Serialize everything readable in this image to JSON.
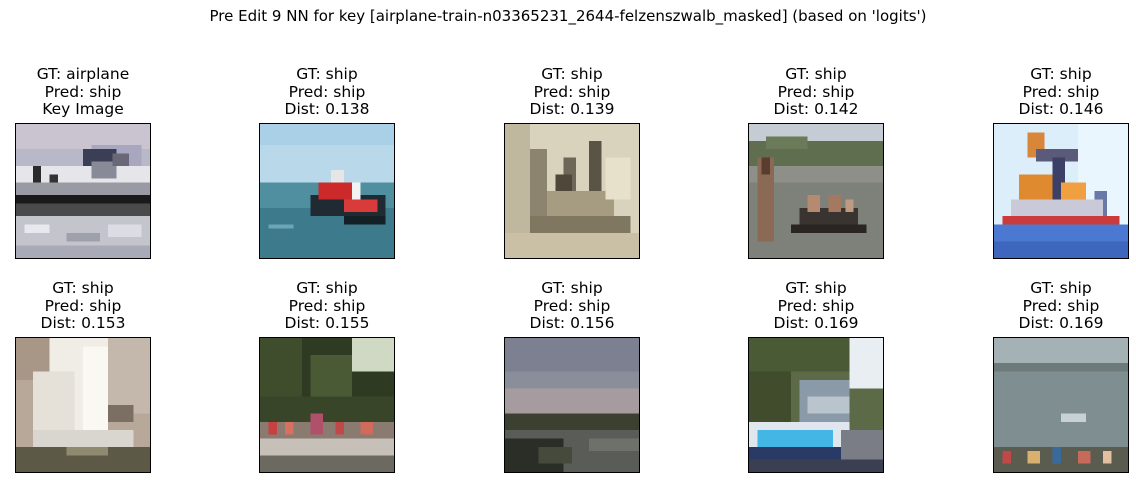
{
  "title": "Pre Edit 9 NN for key [airplane-train-n03365231_2644-felzenszwalb_masked] (based on 'logits')",
  "panels": [
    {
      "gt": "GT: airplane",
      "pred": "Pred: ship",
      "extra": "Key Image",
      "scene": "key-airplane"
    },
    {
      "gt": "GT: ship",
      "pred": "Pred: ship",
      "extra": "Dist: 0.138",
      "scene": "red-boat-sea"
    },
    {
      "gt": "GT: ship",
      "pred": "Pred: ship",
      "extra": "Dist: 0.139",
      "scene": "sepia-ship"
    },
    {
      "gt": "GT: ship",
      "pred": "Pred: ship",
      "extra": "Dist: 0.142",
      "scene": "people-rowboat"
    },
    {
      "gt": "GT: ship",
      "pred": "Pred: ship",
      "extra": "Dist: 0.146",
      "scene": "crane-ship"
    },
    {
      "gt": "GT: ship",
      "pred": "Pred: ship",
      "extra": "Dist: 0.153",
      "scene": "sailboat"
    },
    {
      "gt": "GT: ship",
      "pred": "Pred: ship",
      "extra": "Dist: 0.155",
      "scene": "crowded-boat"
    },
    {
      "gt": "GT: ship",
      "pred": "Pred: ship",
      "extra": "Dist: 0.156",
      "scene": "dusk-water"
    },
    {
      "gt": "GT: ship",
      "pred": "Pred: ship",
      "extra": "Dist: 0.169",
      "scene": "canal-boat"
    },
    {
      "gt": "GT: ship",
      "pred": "Pred: ship",
      "extra": "Dist: 0.169",
      "scene": "grey-sea-people"
    }
  ]
}
